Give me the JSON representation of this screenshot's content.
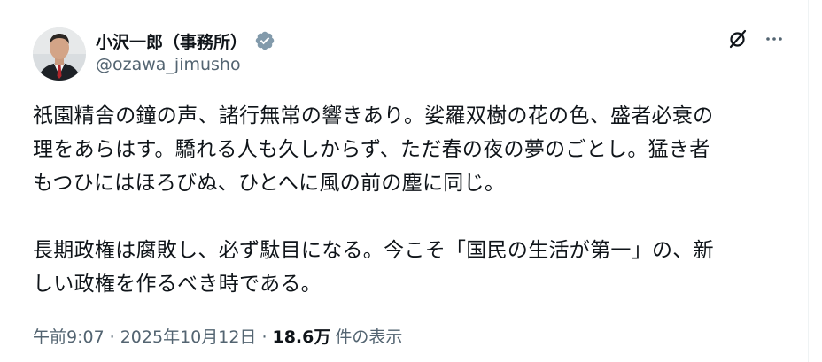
{
  "author": {
    "display_name": "小沢一郎（事務所）",
    "handle": "@ozawa_jimusho",
    "verified_color": "#829aab"
  },
  "tweet": {
    "paragraphs": [
      "祇園精舎の鐘の声、諸行無常の響きあり。娑羅双樹の花の色、盛者必衰の\n理をあらはす。驕れる人も久しからず、ただ春の夜の夢のごとし。猛き者\nもつひにはほろびぬ、ひとへに風の前の塵に同じ。",
      "長期政権は腐敗し、必ず駄目になる。今こそ「国民の生活が第一」の、新\nしい政権を作るべき時である。"
    ]
  },
  "meta": {
    "time": "午前9:07",
    "separator": "·",
    "date": "2025年10月12日",
    "views_count": "18.6万",
    "views_label": "件の表示"
  },
  "icons": {
    "grok": "grok-icon",
    "more": "more-icon",
    "verified": "verified-badge-icon"
  },
  "colors": {
    "text_primary": "#0f1419",
    "text_secondary": "#536471",
    "verified_gray": "#829aab"
  }
}
